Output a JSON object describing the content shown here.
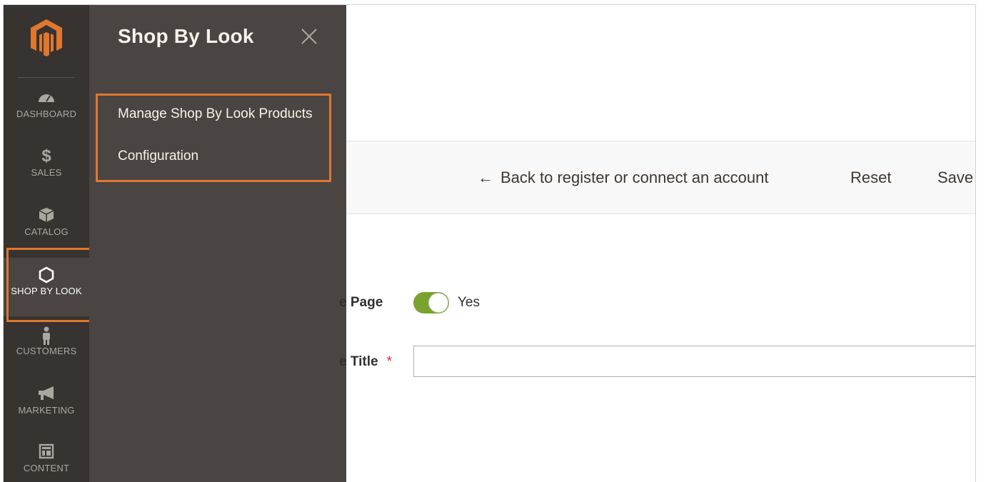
{
  "admin_nav": {
    "items": [
      {
        "label": "DASHBOARD",
        "icon": "dashboard-gauge-icon"
      },
      {
        "label": "SALES",
        "icon": "dollar-icon"
      },
      {
        "label": "CATALOG",
        "icon": "box-icon"
      },
      {
        "label": "SHOP BY LOOK",
        "icon": "hexagon-icon",
        "active": true
      },
      {
        "label": "CUSTOMERS",
        "icon": "person-icon"
      },
      {
        "label": "MARKETING",
        "icon": "megaphone-icon"
      },
      {
        "label": "CONTENT",
        "icon": "layout-icon"
      }
    ]
  },
  "submenu": {
    "title": "Shop By Look",
    "links": [
      "Manage Shop By Look Products",
      "Configuration"
    ]
  },
  "actions": {
    "back_arrow": "←",
    "back_label": "Back to register or connect an account",
    "reset_label": "Reset",
    "save_label": "Save"
  },
  "form": {
    "enable_label": "e Page",
    "enable_value": "Yes",
    "title_label": "e Title",
    "required_mark": "*",
    "title_value": ""
  },
  "colors": {
    "nav_bg": "#373330",
    "submenu_bg": "#4a4542",
    "highlight": "#e0772e",
    "toggle_on": "#79a22e",
    "logo_orange": "#e0772e"
  }
}
